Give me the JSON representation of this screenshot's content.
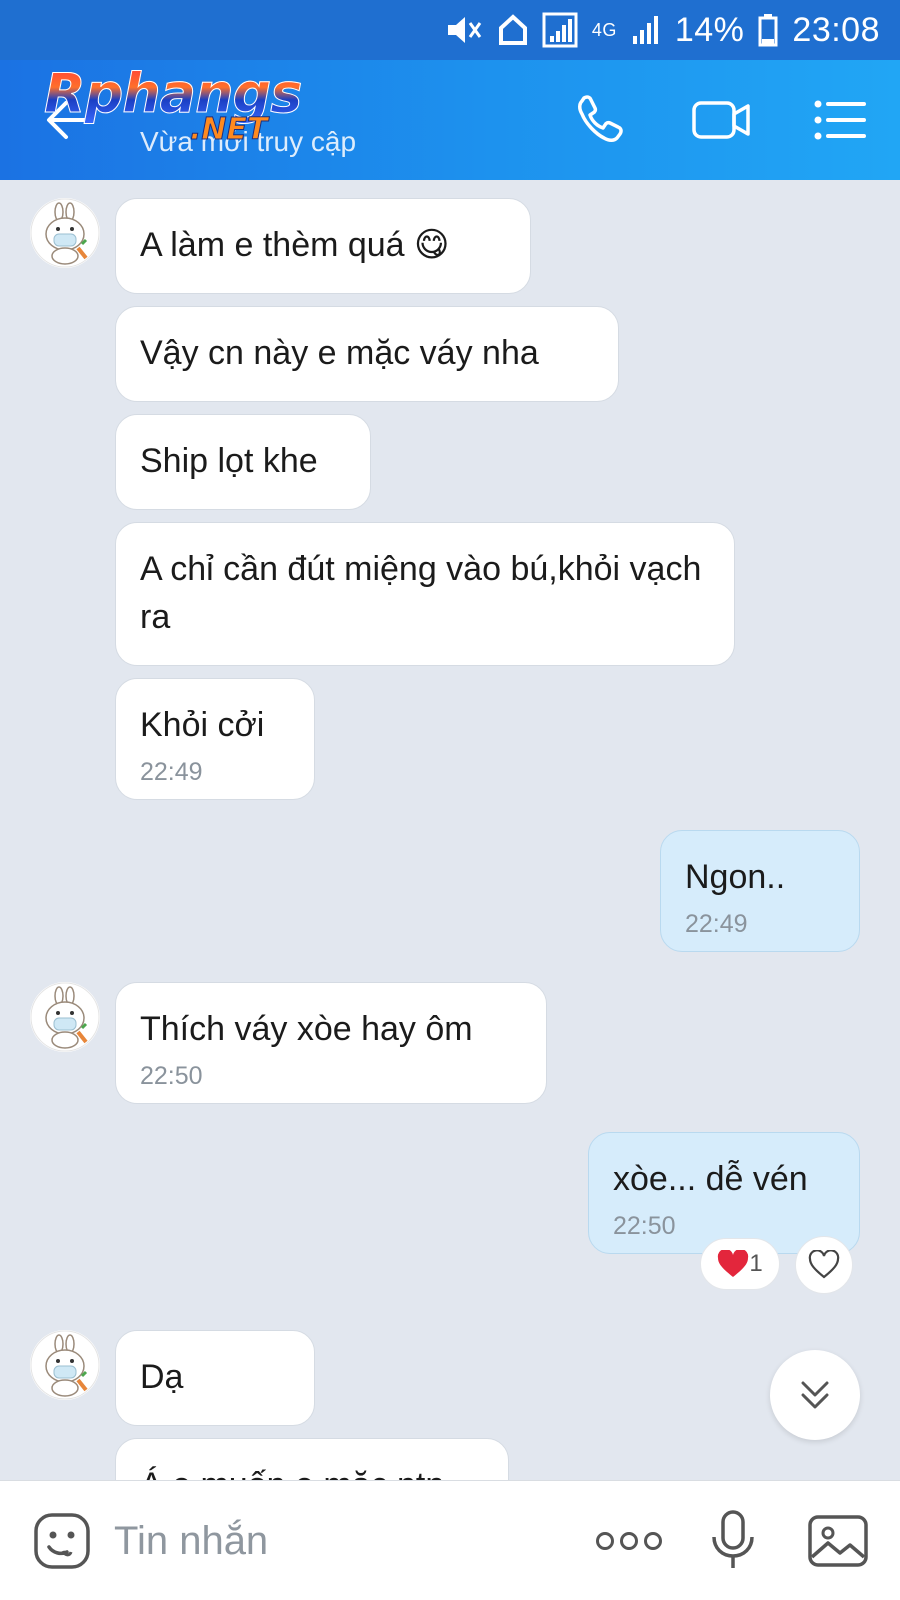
{
  "status_bar": {
    "network_label": "4G",
    "battery": "14%",
    "time": "23:08"
  },
  "header": {
    "logo_text": "Rphangs",
    "logo_sub": ".NET",
    "subtitle": "Vừa mới truy cập",
    "icons": [
      "back-arrow-icon",
      "phone-icon",
      "video-camera-icon",
      "menu-list-icon"
    ]
  },
  "messages": [
    {
      "direction": "in",
      "text": "A làm e thèm quá 😋",
      "time": ""
    },
    {
      "direction": "in",
      "text": "Vậy cn này e mặc váy nha",
      "time": ""
    },
    {
      "direction": "in",
      "text": "Ship lọt khe",
      "time": ""
    },
    {
      "direction": "in",
      "text": "A chỉ cần đút miệng vào bú,khỏi vạch ra",
      "time": ""
    },
    {
      "direction": "in",
      "text": "Khỏi cởi",
      "time": "22:49"
    },
    {
      "direction": "out",
      "text": "Ngon..",
      "time": "22:49"
    },
    {
      "direction": "in",
      "text": "Thích váy xòe hay ôm",
      "time": "22:50"
    },
    {
      "direction": "out",
      "text": "xòe... dễ vén",
      "time": "22:50",
      "reaction_count": "1"
    },
    {
      "direction": "in",
      "text": "Dạ",
      "time": ""
    },
    {
      "direction": "in",
      "text": "Á e muốn e mặc ntn",
      "time": ""
    }
  ],
  "input": {
    "placeholder": "Tin nhắn"
  },
  "colors": {
    "header_start": "#1b72e3",
    "header_end": "#21a6f5",
    "chat_bg": "#e2e7ef",
    "outgoing_bubble": "#d6ecfb",
    "incoming_bubble": "#ffffff"
  }
}
